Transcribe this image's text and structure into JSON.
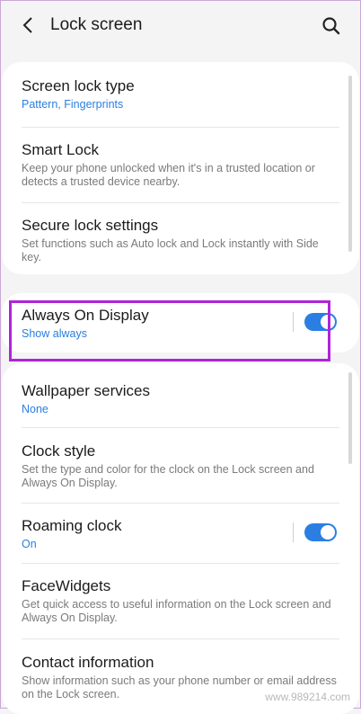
{
  "header": {
    "title": "Lock screen"
  },
  "icons": {
    "back": "chevron-left-icon",
    "search": "search-icon"
  },
  "colors": {
    "accent": "#2b7fe3",
    "highlight": "#b024d8"
  },
  "sections": {
    "security": {
      "screen_lock_type": {
        "title": "Screen lock type",
        "subtitle": "Pattern, Fingerprints"
      },
      "smart_lock": {
        "title": "Smart Lock",
        "subtitle": "Keep your phone unlocked when it's in a trusted location or detects a trusted device nearby."
      },
      "secure_lock_settings": {
        "title": "Secure lock settings",
        "subtitle": "Set functions such as Auto lock and Lock instantly with Side key."
      }
    },
    "aod": {
      "title": "Always On Display",
      "subtitle": "Show always",
      "enabled": true
    },
    "display": {
      "wallpaper_services": {
        "title": "Wallpaper services",
        "subtitle": "None"
      },
      "clock_style": {
        "title": "Clock style",
        "subtitle": "Set the type and color for the clock on the Lock screen and Always On Display."
      },
      "roaming_clock": {
        "title": "Roaming clock",
        "subtitle": "On",
        "enabled": true
      },
      "facewidgets": {
        "title": "FaceWidgets",
        "subtitle": "Get quick access to useful information on the Lock screen and Always On Display."
      },
      "contact_information": {
        "title": "Contact information",
        "subtitle": "Show information such as your phone number or email address on the Lock screen."
      }
    }
  },
  "watermark": "www.989214.com"
}
